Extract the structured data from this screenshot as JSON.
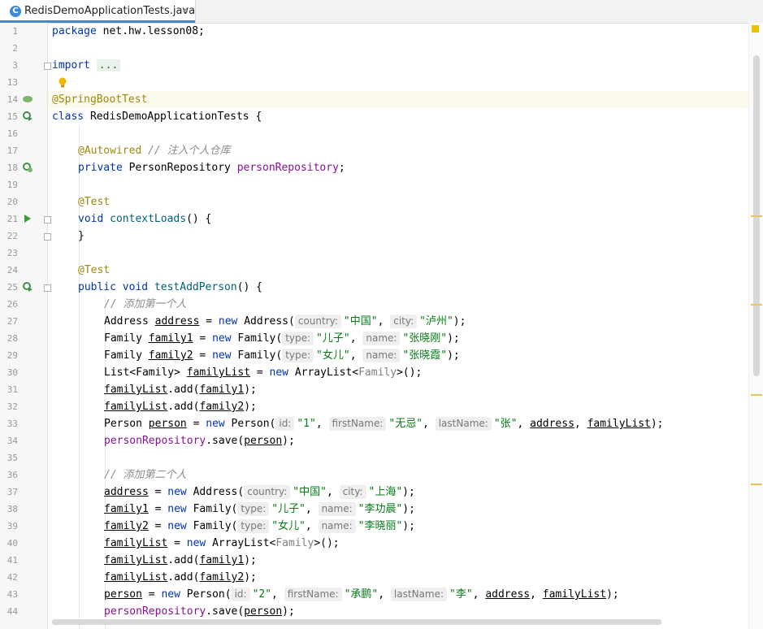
{
  "tab": {
    "icon_letter": "C",
    "title": "RedisDemoApplicationTests.java",
    "close": "×"
  },
  "lines": {
    "l1": "1",
    "l2": "2",
    "l3": "3",
    "l13": "13",
    "l14": "14",
    "l15": "15",
    "l16": "16",
    "l17": "17",
    "l18": "18",
    "l19": "19",
    "l20": "20",
    "l21": "21",
    "l22": "22",
    "l23": "23",
    "l24": "24",
    "l25": "25",
    "l26": "26",
    "l27": "27",
    "l28": "28",
    "l29": "29",
    "l30": "30",
    "l31": "31",
    "l32": "32",
    "l33": "33",
    "l34": "34",
    "l35": "35",
    "l36": "36",
    "l37": "37",
    "l38": "38",
    "l39": "39",
    "l40": "40",
    "l41": "41",
    "l42": "42",
    "l43": "43",
    "l44": "44"
  },
  "gutter_icons": {
    "bean": "spring-bean-icon",
    "run": "run-test-icon",
    "run_rerun": "rerun-test-icon",
    "bulb": "lightbulb-icon"
  },
  "code": {
    "t": {
      "package": "package",
      "pkgname": " net.hw.lesson08;",
      "import": "import",
      "dots": "...",
      "ann_sbt": "@SpringBootTest",
      "class": "class",
      "classname": " RedisDemoApplicationTests {",
      "ann_autowired": "@Autowired",
      "c_inject": " // 注入个人仓库",
      "private": "private",
      "ptype": " PersonRepository ",
      "pfield": "personRepository",
      "semi": ";",
      "ann_test": "@Test",
      "void": "void",
      "m_ctx": "contextLoads",
      "parens_open": "() {",
      "close": "}",
      "public": "public",
      "m_add": "testAddPerson",
      "c_first": "// 添加第一个人",
      "c_second": "// 添加第二个人",
      "Address": "Address",
      "v_address": "address",
      "eq": " = ",
      "new": "new",
      "addr_open": " Address(",
      "h_country": "country:",
      "s_china": "\"中国\"",
      "comma": ", ",
      "h_city": "city:",
      "s_luzhou": "\"泸州\"",
      "end_paren": ");",
      "Family": "Family",
      "v_family1": "family1",
      "v_family2": "family2",
      "fam_open": " Family(",
      "h_type": "type:",
      "s_son": "\"儿子\"",
      "h_name": "name:",
      "s_zxg": "\"张晓刚\"",
      "s_daughter": "\"女儿\"",
      "s_zxx": "\"张晓霞\"",
      "list_type": "List<Family> ",
      "v_familyList": "familyList",
      "arraylist": " ArrayList<",
      "gen_family": "Family",
      "gen_close": ">();",
      "add_call": ".add(",
      "close_paren": ");",
      "Person": "Person",
      "v_person": "person",
      "person_open": " Person(",
      "h_id": "id:",
      "s_1": "\"1\"",
      "h_first": "firstName:",
      "s_wuji": "\"无忌\"",
      "h_last": "lastName:",
      "s_zhang": "\"张\"",
      "save_call": ".save(",
      "s_shanghai": "\"上海\"",
      "s_lgc": "\"李功晨\"",
      "s_lxl": "\"李晓丽\"",
      "s_2": "\"2\"",
      "s_chengpeng": "\"承鹏\"",
      "s_li": "\"李\"",
      "space": " "
    }
  }
}
